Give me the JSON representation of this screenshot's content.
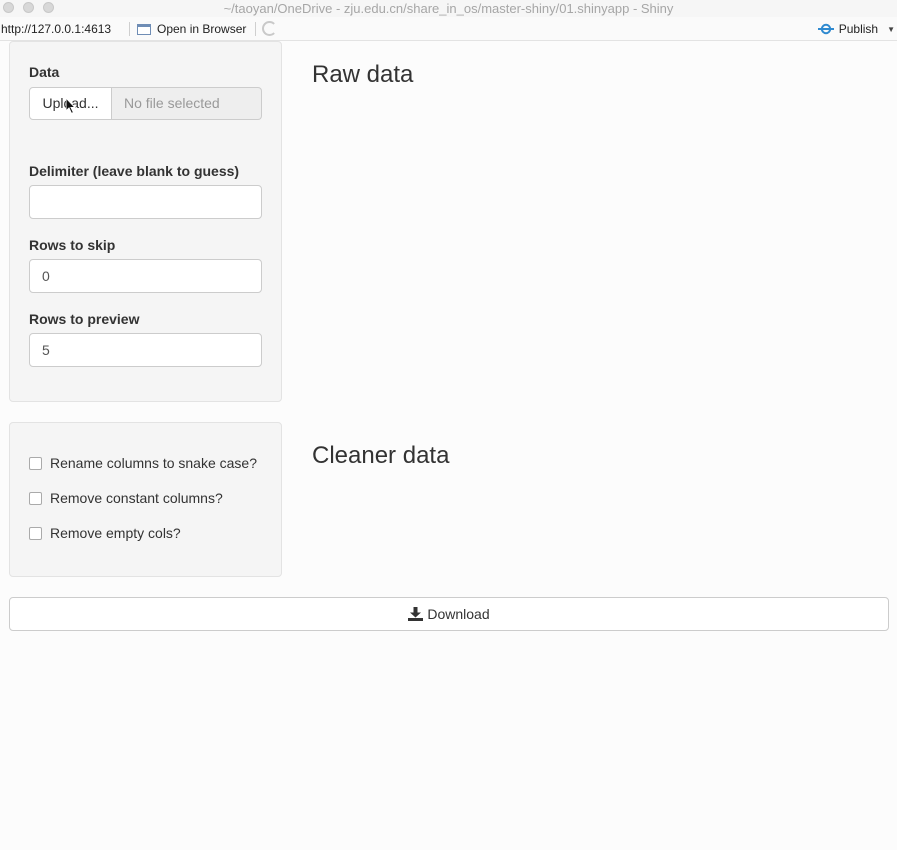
{
  "window": {
    "title": "~/taoyan/OneDrive - zju.edu.cn/share_in_os/master-shiny/01.shinyapp - Shiny"
  },
  "toolbar": {
    "url": "http://127.0.0.1:4613",
    "open_in_browser": "Open in Browser",
    "publish": "Publish",
    "publish_icon": "rstudio-connect-icon",
    "refresh_icon": "refresh-icon"
  },
  "sidebar": {
    "data_label": "Data",
    "upload_button": "Upload...",
    "file_placeholder": "No file selected",
    "delimiter_label": "Delimiter (leave blank to guess)",
    "delimiter_value": "",
    "skip_label": "Rows to skip",
    "skip_value": "0",
    "preview_label": "Rows to preview",
    "preview_value": "5"
  },
  "options": {
    "rename_snake": "Rename columns to snake case?",
    "remove_constant": "Remove constant columns?",
    "remove_empty": "Remove empty cols?"
  },
  "main": {
    "raw_heading": "Raw data",
    "clean_heading": "Cleaner data"
  },
  "download": {
    "label": "Download",
    "icon": "download-icon"
  },
  "colors": {
    "publish_accent": "#2f8ad0"
  }
}
